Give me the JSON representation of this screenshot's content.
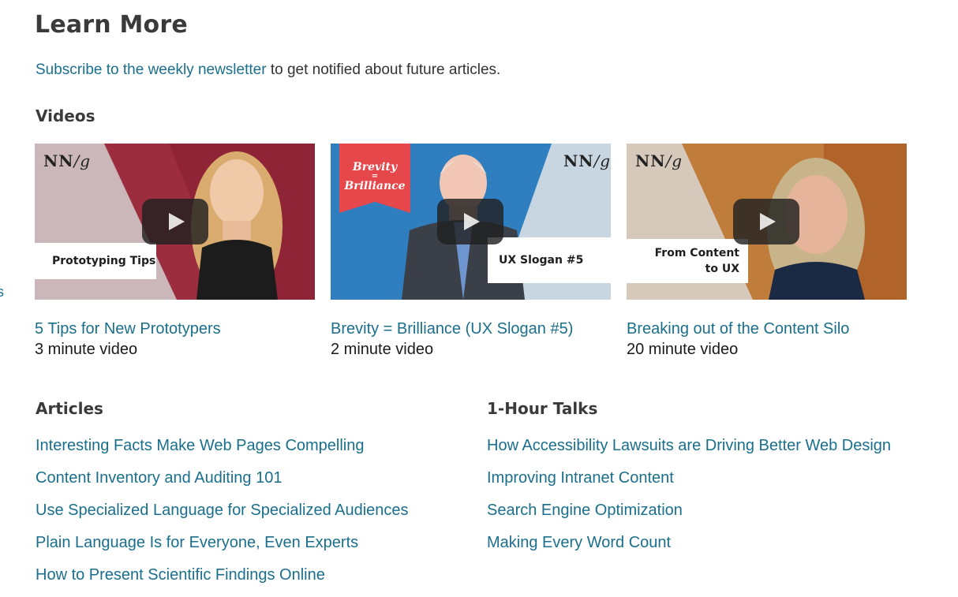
{
  "learn_more": {
    "title": "Learn More",
    "newsletter_link": "Subscribe to the weekly newsletter",
    "newsletter_rest": " to get notified about future articles."
  },
  "videos": {
    "heading": "Videos",
    "items": [
      {
        "thumb_logo": "NN",
        "thumb_logo_g": "/g",
        "thumb_caption": "Prototyping Tips",
        "title": "5 Tips for New Prototypers",
        "length": "3 minute video"
      },
      {
        "thumb_logo": "NN",
        "thumb_logo_g": "/g",
        "thumb_caption": "UX Slogan #5",
        "sign_line1": "Brevity",
        "sign_line2": "=",
        "sign_line3": "Brilliance",
        "title": "Brevity = Brilliance (UX Slogan #5)",
        "length": "2 minute video"
      },
      {
        "thumb_logo": "NN",
        "thumb_logo_g": "/g",
        "thumb_caption_line1": "From Content",
        "thumb_caption_line2": "to UX",
        "title": "Breaking out of the Content Silo",
        "length": "20 minute video"
      }
    ]
  },
  "articles": {
    "heading": "Articles",
    "items": [
      "Interesting Facts Make Web Pages Compelling",
      "Content Inventory and Auditing 101",
      "Use Specialized Language for Specialized Audiences",
      "Plain Language Is for Everyone, Even Experts",
      "How to Present Scientific Findings Online"
    ]
  },
  "talks": {
    "heading": "1-Hour Talks",
    "items": [
      "How Accessibility Lawsuits are Driving Better Web Design",
      "Improving Intranet Content",
      "Search Engine Optimization",
      "Making Every Word Count"
    ]
  },
  "edge_fragment": "s",
  "colors": {
    "link": "#1a6f8c",
    "text": "#2b2b2b",
    "heading": "#3a3a3a",
    "play_button": "#212121"
  }
}
